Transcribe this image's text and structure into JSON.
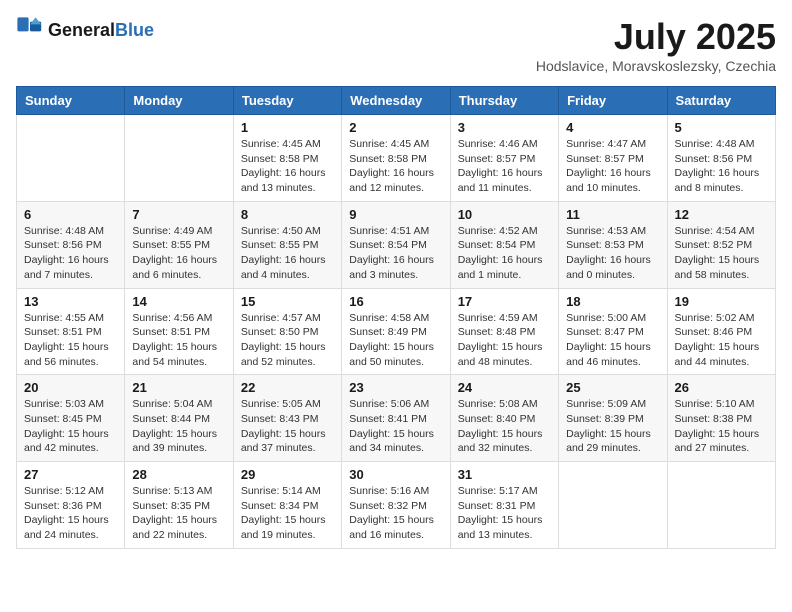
{
  "header": {
    "logo": {
      "general": "General",
      "blue": "Blue"
    },
    "title": "July 2025",
    "subtitle": "Hodslavice, Moravskoslezsky, Czechia"
  },
  "days_of_week": [
    "Sunday",
    "Monday",
    "Tuesday",
    "Wednesday",
    "Thursday",
    "Friday",
    "Saturday"
  ],
  "weeks": [
    [
      {
        "day": "",
        "info": ""
      },
      {
        "day": "",
        "info": ""
      },
      {
        "day": "1",
        "info": "Sunrise: 4:45 AM\nSunset: 8:58 PM\nDaylight: 16 hours and 13 minutes."
      },
      {
        "day": "2",
        "info": "Sunrise: 4:45 AM\nSunset: 8:58 PM\nDaylight: 16 hours and 12 minutes."
      },
      {
        "day": "3",
        "info": "Sunrise: 4:46 AM\nSunset: 8:57 PM\nDaylight: 16 hours and 11 minutes."
      },
      {
        "day": "4",
        "info": "Sunrise: 4:47 AM\nSunset: 8:57 PM\nDaylight: 16 hours and 10 minutes."
      },
      {
        "day": "5",
        "info": "Sunrise: 4:48 AM\nSunset: 8:56 PM\nDaylight: 16 hours and 8 minutes."
      }
    ],
    [
      {
        "day": "6",
        "info": "Sunrise: 4:48 AM\nSunset: 8:56 PM\nDaylight: 16 hours and 7 minutes."
      },
      {
        "day": "7",
        "info": "Sunrise: 4:49 AM\nSunset: 8:55 PM\nDaylight: 16 hours and 6 minutes."
      },
      {
        "day": "8",
        "info": "Sunrise: 4:50 AM\nSunset: 8:55 PM\nDaylight: 16 hours and 4 minutes."
      },
      {
        "day": "9",
        "info": "Sunrise: 4:51 AM\nSunset: 8:54 PM\nDaylight: 16 hours and 3 minutes."
      },
      {
        "day": "10",
        "info": "Sunrise: 4:52 AM\nSunset: 8:54 PM\nDaylight: 16 hours and 1 minute."
      },
      {
        "day": "11",
        "info": "Sunrise: 4:53 AM\nSunset: 8:53 PM\nDaylight: 16 hours and 0 minutes."
      },
      {
        "day": "12",
        "info": "Sunrise: 4:54 AM\nSunset: 8:52 PM\nDaylight: 15 hours and 58 minutes."
      }
    ],
    [
      {
        "day": "13",
        "info": "Sunrise: 4:55 AM\nSunset: 8:51 PM\nDaylight: 15 hours and 56 minutes."
      },
      {
        "day": "14",
        "info": "Sunrise: 4:56 AM\nSunset: 8:51 PM\nDaylight: 15 hours and 54 minutes."
      },
      {
        "day": "15",
        "info": "Sunrise: 4:57 AM\nSunset: 8:50 PM\nDaylight: 15 hours and 52 minutes."
      },
      {
        "day": "16",
        "info": "Sunrise: 4:58 AM\nSunset: 8:49 PM\nDaylight: 15 hours and 50 minutes."
      },
      {
        "day": "17",
        "info": "Sunrise: 4:59 AM\nSunset: 8:48 PM\nDaylight: 15 hours and 48 minutes."
      },
      {
        "day": "18",
        "info": "Sunrise: 5:00 AM\nSunset: 8:47 PM\nDaylight: 15 hours and 46 minutes."
      },
      {
        "day": "19",
        "info": "Sunrise: 5:02 AM\nSunset: 8:46 PM\nDaylight: 15 hours and 44 minutes."
      }
    ],
    [
      {
        "day": "20",
        "info": "Sunrise: 5:03 AM\nSunset: 8:45 PM\nDaylight: 15 hours and 42 minutes."
      },
      {
        "day": "21",
        "info": "Sunrise: 5:04 AM\nSunset: 8:44 PM\nDaylight: 15 hours and 39 minutes."
      },
      {
        "day": "22",
        "info": "Sunrise: 5:05 AM\nSunset: 8:43 PM\nDaylight: 15 hours and 37 minutes."
      },
      {
        "day": "23",
        "info": "Sunrise: 5:06 AM\nSunset: 8:41 PM\nDaylight: 15 hours and 34 minutes."
      },
      {
        "day": "24",
        "info": "Sunrise: 5:08 AM\nSunset: 8:40 PM\nDaylight: 15 hours and 32 minutes."
      },
      {
        "day": "25",
        "info": "Sunrise: 5:09 AM\nSunset: 8:39 PM\nDaylight: 15 hours and 29 minutes."
      },
      {
        "day": "26",
        "info": "Sunrise: 5:10 AM\nSunset: 8:38 PM\nDaylight: 15 hours and 27 minutes."
      }
    ],
    [
      {
        "day": "27",
        "info": "Sunrise: 5:12 AM\nSunset: 8:36 PM\nDaylight: 15 hours and 24 minutes."
      },
      {
        "day": "28",
        "info": "Sunrise: 5:13 AM\nSunset: 8:35 PM\nDaylight: 15 hours and 22 minutes."
      },
      {
        "day": "29",
        "info": "Sunrise: 5:14 AM\nSunset: 8:34 PM\nDaylight: 15 hours and 19 minutes."
      },
      {
        "day": "30",
        "info": "Sunrise: 5:16 AM\nSunset: 8:32 PM\nDaylight: 15 hours and 16 minutes."
      },
      {
        "day": "31",
        "info": "Sunrise: 5:17 AM\nSunset: 8:31 PM\nDaylight: 15 hours and 13 minutes."
      },
      {
        "day": "",
        "info": ""
      },
      {
        "day": "",
        "info": ""
      }
    ]
  ]
}
